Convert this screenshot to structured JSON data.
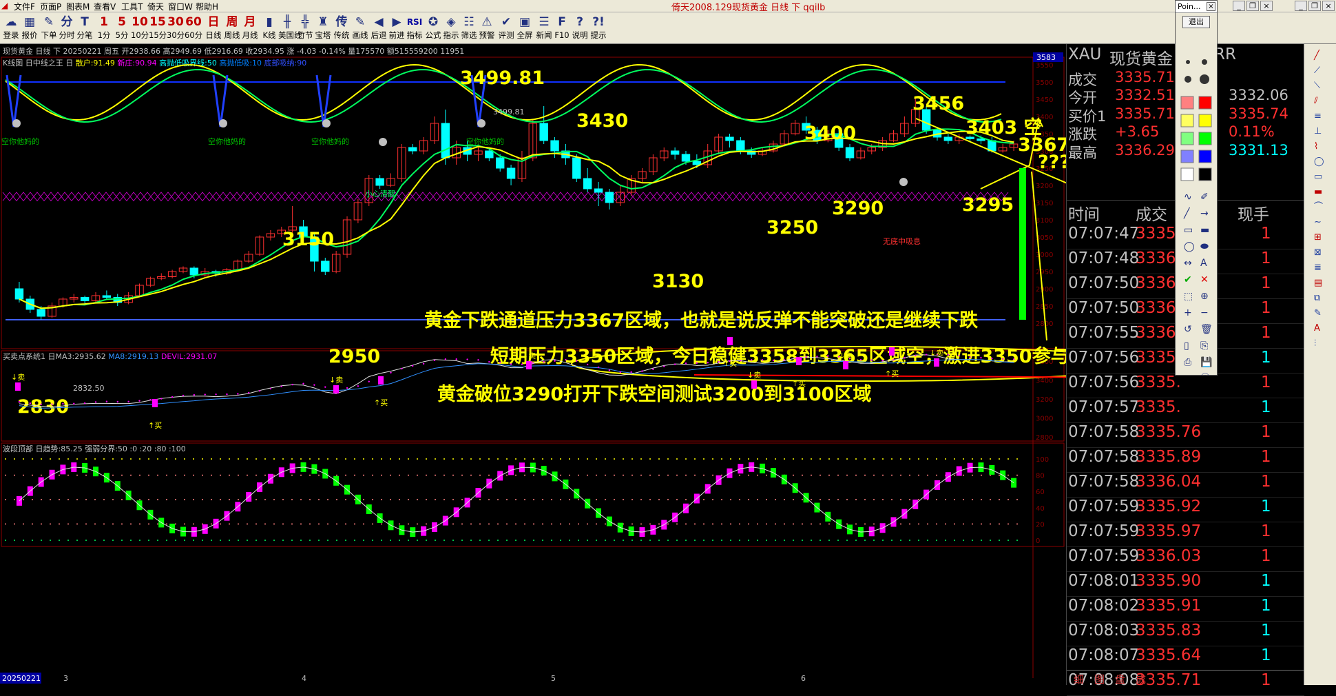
{
  "window": {
    "title": "倚天2008.129现货黄金 日线 下 qqilb",
    "menus": [
      "文件F",
      "页面P",
      "图表M",
      "查看V",
      "工具T",
      "倚天",
      "窗口W",
      "帮助H"
    ]
  },
  "toolbar": {
    "items": [
      {
        "label": "登录",
        "icon": "☁"
      },
      {
        "label": "报价",
        "icon": "▦"
      },
      {
        "label": "下单",
        "icon": "✎"
      },
      {
        "label": "分时",
        "icon": "分"
      },
      {
        "label": "分笔",
        "icon": "T"
      },
      {
        "label": "1分",
        "icon": "1"
      },
      {
        "label": "5分",
        "icon": "5"
      },
      {
        "label": "10分",
        "icon": "10"
      },
      {
        "label": "15分",
        "icon": "15"
      },
      {
        "label": "30分",
        "icon": "30"
      },
      {
        "label": "60分",
        "icon": "60"
      },
      {
        "label": "日线",
        "icon": "日"
      },
      {
        "label": "周线",
        "icon": "周"
      },
      {
        "label": "月线",
        "icon": "月"
      },
      {
        "label": "K线",
        "icon": "▮"
      },
      {
        "label": "美国线",
        "icon": "╫"
      },
      {
        "label": "竹节",
        "icon": "╬"
      },
      {
        "label": "宝塔",
        "icon": "♜"
      },
      {
        "label": "传统",
        "icon": "传"
      },
      {
        "label": "画线",
        "icon": "✎"
      },
      {
        "label": "后退",
        "icon": "◀"
      },
      {
        "label": "前进",
        "icon": "▶"
      },
      {
        "label": "指标",
        "icon": "RSI"
      },
      {
        "label": "公式",
        "icon": "✪"
      },
      {
        "label": "指示",
        "icon": "◈"
      },
      {
        "label": "筛选",
        "icon": "☷"
      },
      {
        "label": "预警",
        "icon": "⚠"
      },
      {
        "label": "评测",
        "icon": "✔"
      },
      {
        "label": "全屏",
        "icon": "▣"
      },
      {
        "label": "新闻",
        "icon": "☰"
      },
      {
        "label": "F10",
        "icon": "F"
      },
      {
        "label": "说明",
        "icon": "?"
      },
      {
        "label": "提示",
        "icon": "?!"
      }
    ]
  },
  "chart_header": {
    "line1": "现货黄金 日线 下 20250221 周五 开2938.66 高2949.69 低2916.69 收2934.95 涨 -4.03 -0.14% 量175570 额515559200 11951",
    "line2_a": "K线图 日中线之王 日",
    "line2_b": "散户:91.49",
    "line2_c": "新庄:90.94",
    "line2_d": "高抛低吸界线:50",
    "line2_e": "高抛低吸:10",
    "line2_f": "底部吸纳:90",
    "indicator2_a": "买卖点系统1 日MA3:2935.62",
    "indicator2_b": "MA8:2919.13",
    "indicator2_c": "DEVIL:2931.07",
    "indicator3": "波段顶部 日趋势:85.25 强弱分界:50 :0 :20 :80 :100",
    "date_box": "20250221",
    "price_tag": "3583"
  },
  "chart_data": {
    "type": "candlestick",
    "main_axis": {
      "min": 2800,
      "max": 3550,
      "ticks": [
        3550,
        3500,
        3450,
        3400,
        3350,
        3300,
        3250,
        3200,
        3150,
        3100,
        3050,
        3000,
        2950,
        2900,
        2850,
        2800
      ]
    },
    "mid_axis": {
      "ticks": [
        3600,
        3400,
        3200,
        3000,
        2800
      ]
    },
    "low_axis": {
      "ticks": [
        100,
        80,
        60,
        40,
        20,
        0
      ]
    },
    "x_labels": [
      "3",
      "4",
      "5",
      "6"
    ],
    "candles": [
      [
        2900,
        2870,
        2920,
        2860
      ],
      [
        2870,
        2840,
        2880,
        2830
      ],
      [
        2840,
        2820,
        2850,
        2810
      ],
      [
        2820,
        2850,
        2860,
        2815
      ],
      [
        2850,
        2870,
        2875,
        2845
      ],
      [
        2870,
        2875,
        2885,
        2860
      ],
      [
        2875,
        2865,
        2880,
        2855
      ],
      [
        2865,
        2880,
        2890,
        2860
      ],
      [
        2880,
        2875,
        2895,
        2870
      ],
      [
        2875,
        2860,
        2885,
        2850
      ],
      [
        2860,
        2880,
        2890,
        2855
      ],
      [
        2880,
        2910,
        2915,
        2875
      ],
      [
        2910,
        2930,
        2935,
        2905
      ],
      [
        2930,
        2935,
        2945,
        2925
      ],
      [
        2935,
        2950,
        2955,
        2930
      ],
      [
        2950,
        2960,
        2965,
        2945
      ],
      [
        2960,
        2940,
        2965,
        2930
      ],
      [
        2940,
        2950,
        2960,
        2935
      ],
      [
        2950,
        2945,
        2955,
        2935
      ],
      [
        2945,
        2955,
        2960,
        2940
      ],
      [
        2955,
        2980,
        2985,
        2950
      ],
      [
        2980,
        3000,
        3010,
        2975
      ],
      [
        3000,
        3050,
        3055,
        2995
      ],
      [
        3050,
        3060,
        3070,
        3040
      ],
      [
        3060,
        3070,
        3080,
        3050
      ],
      [
        3070,
        3080,
        3140,
        3060
      ],
      [
        3080,
        3050,
        3100,
        3040
      ],
      [
        3050,
        2980,
        3060,
        2950
      ],
      [
        2980,
        2950,
        2990,
        2940
      ],
      [
        2950,
        3000,
        3010,
        2945
      ],
      [
        3000,
        3100,
        3110,
        2990
      ],
      [
        3100,
        3150,
        3160,
        3090
      ],
      [
        3150,
        3220,
        3230,
        3140
      ],
      [
        3220,
        3200,
        3230,
        3190
      ],
      [
        3200,
        3220,
        3235,
        3195
      ],
      [
        3220,
        3310,
        3320,
        3210
      ],
      [
        3310,
        3300,
        3320,
        3290
      ],
      [
        3300,
        3330,
        3340,
        3290
      ],
      [
        3330,
        3380,
        3400,
        3320
      ],
      [
        3380,
        3280,
        3420,
        3260
      ],
      [
        3280,
        3310,
        3330,
        3260
      ],
      [
        3310,
        3290,
        3330,
        3270
      ],
      [
        3290,
        3300,
        3310,
        3270
      ],
      [
        3300,
        3280,
        3310,
        3270
      ],
      [
        3280,
        3250,
        3290,
        3240
      ],
      [
        3250,
        3220,
        3260,
        3200
      ],
      [
        3220,
        3280,
        3300,
        3210
      ],
      [
        3280,
        3380,
        3390,
        3270
      ],
      [
        3380,
        3330,
        3430,
        3320
      ],
      [
        3330,
        3300,
        3340,
        3280
      ],
      [
        3300,
        3280,
        3320,
        3260
      ],
      [
        3280,
        3220,
        3290,
        3210
      ],
      [
        3220,
        3190,
        3250,
        3180
      ],
      [
        3190,
        3180,
        3210,
        3140
      ],
      [
        3180,
        3150,
        3190,
        3130
      ],
      [
        3150,
        3180,
        3200,
        3140
      ],
      [
        3180,
        3220,
        3230,
        3170
      ],
      [
        3220,
        3240,
        3250,
        3210
      ],
      [
        3240,
        3280,
        3290,
        3230
      ],
      [
        3280,
        3300,
        3310,
        3270
      ],
      [
        3300,
        3290,
        3310,
        3275
      ],
      [
        3290,
        3270,
        3300,
        3260
      ],
      [
        3270,
        3260,
        3290,
        3250
      ],
      [
        3260,
        3300,
        3320,
        3250
      ],
      [
        3300,
        3340,
        3350,
        3290
      ],
      [
        3340,
        3330,
        3350,
        3310
      ],
      [
        3330,
        3300,
        3340,
        3290
      ],
      [
        3300,
        3290,
        3310,
        3280
      ],
      [
        3290,
        3300,
        3310,
        3285
      ],
      [
        3300,
        3320,
        3330,
        3295
      ],
      [
        3320,
        3350,
        3360,
        3315
      ],
      [
        3350,
        3380,
        3390,
        3345
      ],
      [
        3380,
        3360,
        3400,
        3350
      ],
      [
        3360,
        3330,
        3370,
        3320
      ],
      [
        3330,
        3350,
        3360,
        3325
      ],
      [
        3350,
        3310,
        3360,
        3300
      ],
      [
        3310,
        3280,
        3320,
        3270
      ],
      [
        3280,
        3300,
        3310,
        3275
      ],
      [
        3300,
        3310,
        3320,
        3290
      ],
      [
        3310,
        3330,
        3340,
        3300
      ],
      [
        3330,
        3350,
        3360,
        3325
      ],
      [
        3350,
        3380,
        3400,
        3340
      ],
      [
        3380,
        3420,
        3456,
        3370
      ],
      [
        3420,
        3360,
        3430,
        3350
      ],
      [
        3360,
        3340,
        3370,
        3330
      ],
      [
        3340,
        3330,
        3350,
        3320
      ],
      [
        3330,
        3340,
        3350,
        3320
      ],
      [
        3340,
        3335,
        3345,
        3325
      ],
      [
        3335,
        3330,
        3345,
        3320
      ],
      [
        3330,
        3300,
        3340,
        3295
      ],
      [
        3300,
        3310,
        3320,
        3295
      ],
      [
        3310,
        3320,
        3330,
        3300
      ]
    ],
    "annotations": {
      "peak_3499": "3499.81",
      "peak_3499_small": "3499.81",
      "peak_3430": "3430",
      "peak_3456": "3456",
      "peak_3400": "3400",
      "peak_3403": "3403 空",
      "peak_3367": "3367",
      "qmarks": "???",
      "low_3290": "3290",
      "low_3295": "3295",
      "low_3250": "3250",
      "low_3130": "3130",
      "peak_3150": "3150",
      "low_2950": "2950",
      "low_2830": "2830",
      "low_2830_small": "2832.50",
      "note_warn": "小心清醒",
      "note_nobottom": "无底中吸息",
      "sign_kong1": "空你他妈的",
      "sign_kong2": "空你他妈的",
      "sign_kong3": "空你他妈的",
      "sign_kong4": "空你他妈的",
      "text_line1": "黄金下跌通道压力3367区域，也就是说反弹不能突破还是继续下跌",
      "text_line2": "短期压力3350区域，今日稳健3358到3365区域空，激进3350参与",
      "text_line3": "黄金破位3290打开下跌空间测试3200到3100区域"
    },
    "buy_sell_marks": [
      {
        "label": "↓卖"
      },
      {
        "label": "↑买"
      },
      {
        "label": "↓卖"
      },
      {
        "label": "↑买"
      },
      {
        "label": "↓卖"
      },
      {
        "label": "↑买"
      },
      {
        "label": "↓卖"
      },
      {
        "label": "↑买"
      },
      {
        "label": "↓卖"
      },
      {
        "label": "↑买"
      },
      {
        "label": "↓卖"
      }
    ]
  },
  "quote_panel": {
    "symbol": "XAU",
    "name": "现货黄金",
    "name_suffix": "RR",
    "rows": [
      {
        "l": "成交",
        "v": "3335.71",
        "l2": "",
        "v2": ""
      },
      {
        "l": "今开",
        "v": "3332.51",
        "l2": "",
        "v2": "3332.06"
      },
      {
        "l": "买价1",
        "v": "3335.71",
        "l2": "",
        "v2": "3335.74"
      },
      {
        "l": "涨跌",
        "v": "+3.65",
        "l2": "",
        "v2": "0.11%"
      },
      {
        "l": "最高",
        "v": "3336.29",
        "l2": "",
        "v2": "3331.13"
      }
    ],
    "col_time": "时间",
    "col_price": "成交",
    "col_vol": "现手",
    "ticks": [
      {
        "t": "07:07:47",
        "p": "3335.",
        "v": "1",
        "c": "red"
      },
      {
        "t": "07:07:48",
        "p": "3336.",
        "v": "1",
        "c": "red"
      },
      {
        "t": "07:07:50",
        "p": "3336.",
        "v": "1",
        "c": "red"
      },
      {
        "t": "07:07:50",
        "p": "3336.",
        "v": "1",
        "c": "red"
      },
      {
        "t": "07:07:55",
        "p": "3336.",
        "v": "1",
        "c": "red"
      },
      {
        "t": "07:07:56",
        "p": "3335.",
        "v": "1",
        "c": "cyan"
      },
      {
        "t": "07:07:56",
        "p": "3335.",
        "v": "1",
        "c": "red"
      },
      {
        "t": "07:07:57",
        "p": "3335.",
        "v": "1",
        "c": "cyan"
      },
      {
        "t": "07:07:58",
        "p": "3335.76",
        "v": "1",
        "c": "red"
      },
      {
        "t": "07:07:58",
        "p": "3335.89",
        "v": "1",
        "c": "red"
      },
      {
        "t": "07:07:58",
        "p": "3336.04",
        "v": "1",
        "c": "red"
      },
      {
        "t": "07:07:59",
        "p": "3335.92",
        "v": "1",
        "c": "cyan"
      },
      {
        "t": "07:07:59",
        "p": "3335.97",
        "v": "1",
        "c": "red"
      },
      {
        "t": "07:07:59",
        "p": "3336.03",
        "v": "1",
        "c": "red"
      },
      {
        "t": "07:08:01",
        "p": "3335.90",
        "v": "1",
        "c": "cyan"
      },
      {
        "t": "07:08:02",
        "p": "3335.91",
        "v": "1",
        "c": "cyan"
      },
      {
        "t": "07:08:03",
        "p": "3335.83",
        "v": "1",
        "c": "cyan"
      },
      {
        "t": "07:08:07",
        "p": "3335.64",
        "v": "1",
        "c": "cyan"
      },
      {
        "t": "07:08:08",
        "p": "3335.71",
        "v": "1",
        "c": "red"
      }
    ],
    "bottom_tabs": [
      "细",
      "图",
      "盘",
      "成"
    ]
  },
  "draw_palette": {
    "title": "Poin...",
    "exit_label": "退出"
  }
}
